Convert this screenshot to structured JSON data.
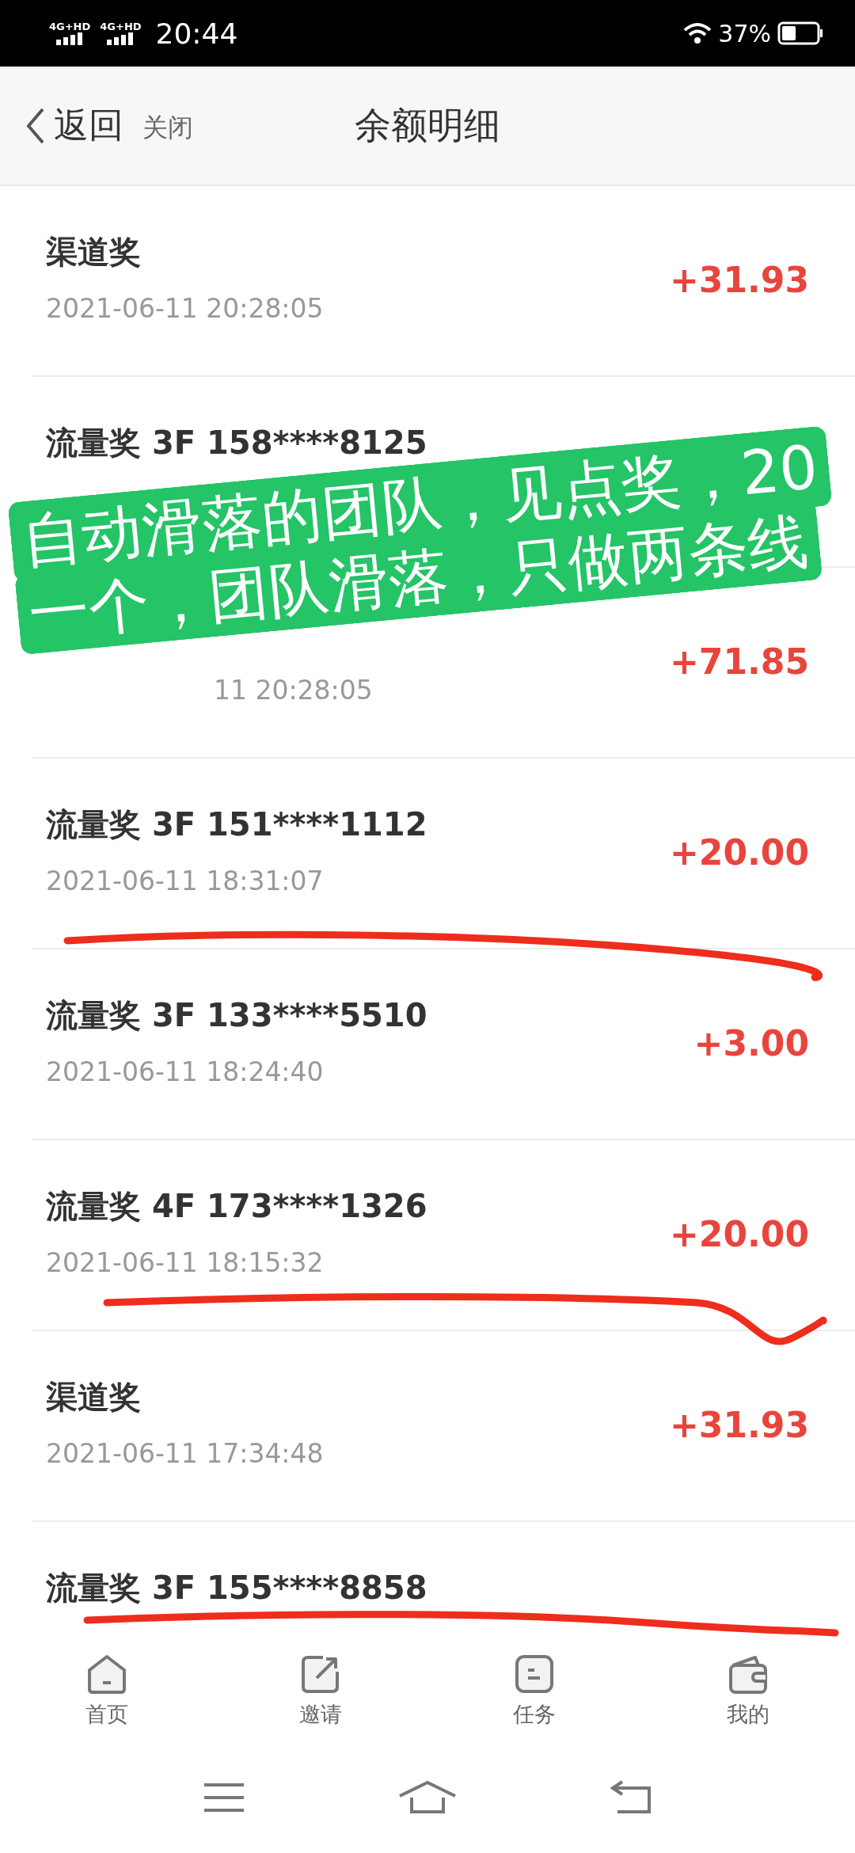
{
  "status_bar": {
    "signals": [
      "4G+HD",
      "4G+HD"
    ],
    "time": "20:44",
    "battery": "37%"
  },
  "header": {
    "back": "返回",
    "close": "关闭",
    "title": "余额明细"
  },
  "records": [
    {
      "kind": "full",
      "title": "渠道奖",
      "date": "2021-06-11 20:28:05",
      "amount": "+31.93"
    },
    {
      "kind": "full",
      "title": "流量奖 3F 158****8125"
    },
    {
      "kind": "covered",
      "date": "11 20:28:05",
      "amount": "+71.85"
    },
    {
      "kind": "full",
      "title": "流量奖 3F 151****1112",
      "date": "2021-06-11 18:31:07",
      "amount": "+20.00"
    },
    {
      "kind": "full",
      "title": "流量奖 3F 133****5510",
      "date": "2021-06-11 18:24:40",
      "amount": "+3.00"
    },
    {
      "kind": "full",
      "title": "流量奖 4F 173****1326",
      "date": "2021-06-11 18:15:32",
      "amount": "+20.00"
    },
    {
      "kind": "full",
      "title": "渠道奖",
      "date": "2021-06-11 17:34:48",
      "amount": "+31.93"
    },
    {
      "kind": "full",
      "title": "流量奖 3F 155****8858"
    }
  ],
  "annotation": "自动滑落的团队，见点奖，20一个，团队滑落，只做两条线",
  "tabs": [
    {
      "label": "首页",
      "selected": false
    },
    {
      "label": "邀请",
      "selected": false
    },
    {
      "label": "任务",
      "selected": false
    },
    {
      "label": "我的",
      "selected": false
    }
  ]
}
